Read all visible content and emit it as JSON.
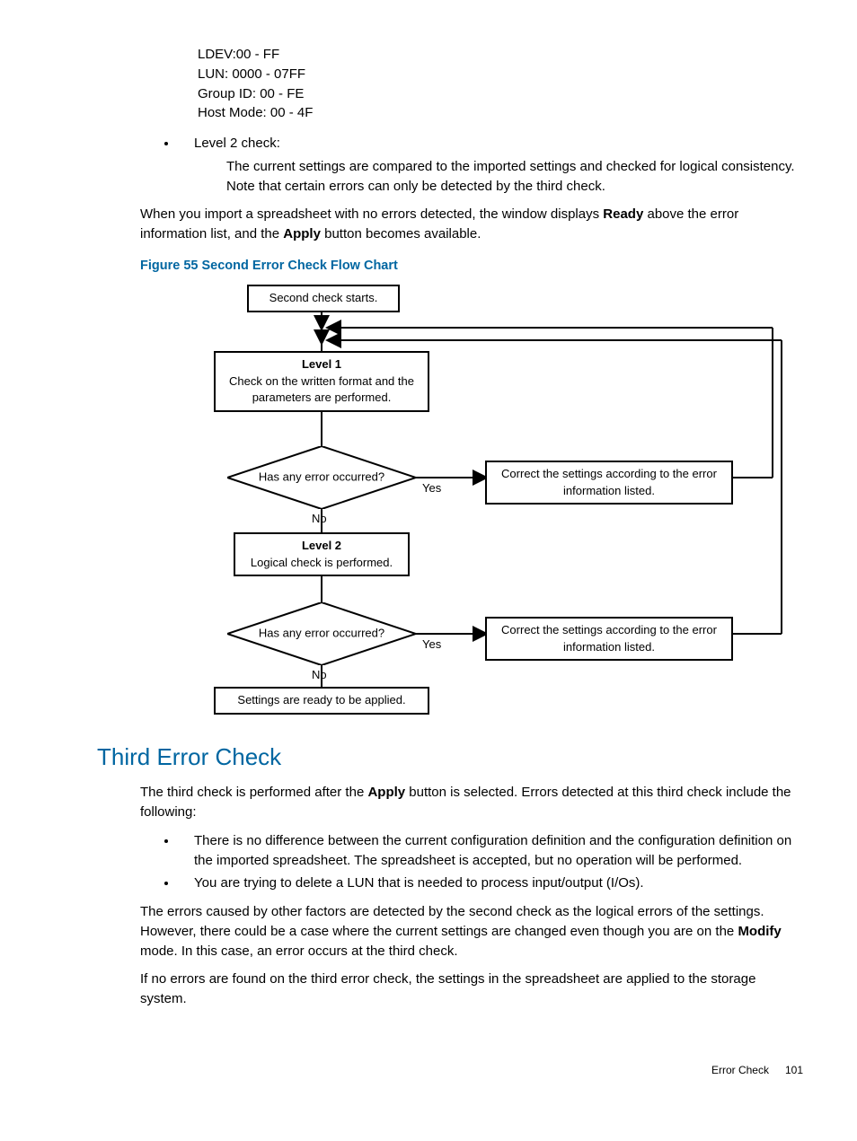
{
  "range_lines": {
    "l1": "LDEV:00 - FF",
    "l2": "LUN: 0000 - 07FF",
    "l3": "Group ID: 00 - FE",
    "l4": "Host Mode: 00 - 4F"
  },
  "level2": {
    "bullet": "Level 2 check:",
    "text": "The current settings are compared to the imported settings and checked for logical consistency. Note that certain errors can only be detected by the third check."
  },
  "import_para": {
    "part1": "When you import a spreadsheet with no errors detected, the window displays ",
    "ready": "Ready",
    "part2": " above the error information list, and the ",
    "apply": "Apply",
    "part3": " button becomes available."
  },
  "figure_caption": "Figure 55 Second Error Check Flow Chart",
  "chart_data": {
    "type": "flowchart",
    "nodes": [
      {
        "id": "start",
        "type": "process",
        "text": "Second check starts."
      },
      {
        "id": "lvl1",
        "type": "process",
        "title": "Level 1",
        "text": "Check on the written format and the parameters are performed."
      },
      {
        "id": "d1",
        "type": "decision",
        "text": "Has any error occurred?"
      },
      {
        "id": "c1",
        "type": "process",
        "text": "Correct the settings according to the error information listed."
      },
      {
        "id": "lvl2",
        "type": "process",
        "title": "Level 2",
        "text": "Logical check is performed."
      },
      {
        "id": "d2",
        "type": "decision",
        "text": "Has any error occurred?"
      },
      {
        "id": "c2",
        "type": "process",
        "text": "Correct the settings according to the error information listed."
      },
      {
        "id": "end",
        "type": "process",
        "text": "Settings are ready to be applied."
      }
    ],
    "edges": [
      {
        "from": "start",
        "to": "lvl1"
      },
      {
        "from": "lvl1",
        "to": "d1"
      },
      {
        "from": "d1",
        "to": "c1",
        "label": "Yes"
      },
      {
        "from": "d1",
        "to": "lvl2",
        "label": "No"
      },
      {
        "from": "c1",
        "to": "lvl1",
        "note": "return"
      },
      {
        "from": "lvl2",
        "to": "d2"
      },
      {
        "from": "d2",
        "to": "c2",
        "label": "Yes"
      },
      {
        "from": "d2",
        "to": "end",
        "label": "No"
      },
      {
        "from": "c2",
        "to": "lvl1",
        "note": "return"
      }
    ],
    "labels": {
      "yes": "Yes",
      "no": "No"
    }
  },
  "third": {
    "heading": "Third Error Check",
    "intro_part1": "The third check is performed after the ",
    "intro_apply": "Apply",
    "intro_part2": " button is selected. Errors detected at this third check include the following:",
    "b1": "There is no difference between the current configuration definition and the configuration definition on the imported spreadsheet. The spreadsheet is accepted, but no operation will be performed.",
    "b2": "You are trying to delete a LUN that is needed to process input/output (I/Os).",
    "para2_part1": "The errors caused by other factors are detected by the second check as the logical errors of the settings. However, there could be a case where the current settings are changed even though you are on the ",
    "para2_modify": "Modify",
    "para2_part2": " mode. In this case, an error occurs at the third check.",
    "para3": "If no errors are found on the third error check, the settings in the spreadsheet are applied to the storage system."
  },
  "footer": {
    "section": "Error Check",
    "page": "101"
  }
}
